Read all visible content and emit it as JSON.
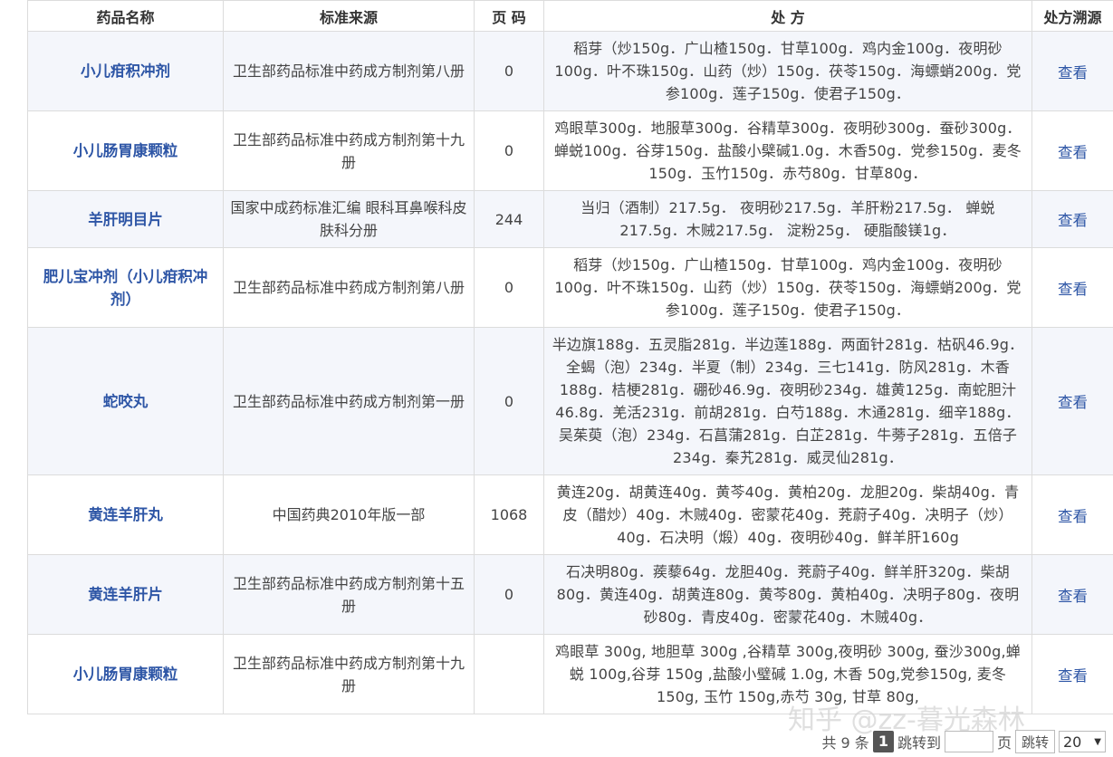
{
  "table": {
    "headers": [
      "药品名称",
      "标准来源",
      "页 码",
      "处 方",
      "处方溯源"
    ],
    "rows": [
      {
        "name": "小儿疳积冲剂",
        "source": "卫生部药品标准中药成方制剂第八册",
        "page": "0",
        "recipe": "稻芽（炒150g．广山楂150g．甘草100g．鸡内金100g．夜明砂100g．叶不珠150g．山药（炒）150g．茯苓150g．海螵蛸200g．党参100g．莲子150g．使君子150g．",
        "link": "查看"
      },
      {
        "name": "小儿肠胃康颗粒",
        "source": "卫生部药品标准中药成方制剂第十九册",
        "page": "0",
        "recipe": "鸡眼草300g．地服草300g．谷精草300g．夜明砂300g．蚕砂300g．蝉蜕100g．谷芽150g．盐酸小檗碱1.0g．木香50g．党参150g．麦冬150g．玉竹150g．赤芍80g．甘草80g．",
        "link": "查看"
      },
      {
        "name": "羊肝明目片",
        "source": "国家中成药标准汇编 眼科耳鼻喉科皮肤科分册",
        "page": "244",
        "recipe": "当归（酒制）217.5g． 夜明砂217.5g．羊肝粉217.5g． 蝉蜕217.5g．木贼217.5g． 淀粉25g． 硬脂酸镁1g．",
        "link": "查看"
      },
      {
        "name": "肥儿宝冲剂（小儿疳积冲剂）",
        "source": "卫生部药品标准中药成方制剂第八册",
        "page": "0",
        "recipe": "稻芽（炒150g．广山楂150g．甘草100g．鸡内金100g．夜明砂100g．叶不珠150g．山药（炒）150g．茯苓150g．海螵蛸200g．党参100g．莲子150g．使君子150g．",
        "link": "查看"
      },
      {
        "name": "蛇咬丸",
        "source": "卫生部药品标准中药成方制剂第一册",
        "page": "0",
        "recipe": "半边旗188g．五灵脂281g．半边莲188g．两面针281g．枯矾46.9g．全蝎（泡）234g．半夏（制）234g．三七141g．防风281g．木香188g．桔梗281g．硼砂46.9g．夜明砂234g．雄黄125g．南蛇胆汁46.8g．羌活231g．前胡281g．白芍188g．木通281g．细辛188g．吴茱萸（泡）234g．石菖蒲281g．白芷281g．牛蒡子281g．五倍子234g．秦艽281g．威灵仙281g．",
        "link": "查看"
      },
      {
        "name": "黄连羊肝丸",
        "source": "中国药典2010年版一部",
        "page": "1068",
        "recipe": "黄连20g．胡黄连40g．黄芩40g．黄柏20g．龙胆20g．柴胡40g．青皮（醋炒）40g．木贼40g．密蒙花40g．茺蔚子40g．决明子（炒）40g．石决明（煅）40g．夜明砂40g．鲜羊肝160g",
        "link": "查看"
      },
      {
        "name": "黄连羊肝片",
        "source": "卫生部药品标准中药成方制剂第十五册",
        "page": "0",
        "recipe": "石决明80g．蒺藜64g．龙胆40g．茺蔚子40g．鲜羊肝320g．柴胡80g．黄连40g．胡黄连80g．黄芩80g．黄柏40g．决明子80g．夜明砂80g．青皮40g．密蒙花40g．木贼40g．",
        "link": "查看"
      },
      {
        "name": "小儿肠胃康颗粒",
        "source": "卫生部药品标准中药成方制剂第十九册",
        "page": "",
        "recipe": "鸡眼草 300g, 地胆草 300g ,谷精草 300g,夜明砂 300g, 蚕沙300g,蝉蜕 100g,谷芽 150g ,盐酸小璧碱 1.0g, 木香 50g,党参150g, 麦冬 150g, 玉竹 150g,赤芍 30g, 甘草 80g,",
        "link": "查看"
      }
    ]
  },
  "pager": {
    "total_label": "共 9 条",
    "current_page": "1",
    "goto_label": "跳转到",
    "goto_value": "",
    "page_unit": "页",
    "goto_button": "跳转",
    "page_size": "20"
  },
  "watermark": "知乎 @zz-暮光森林"
}
